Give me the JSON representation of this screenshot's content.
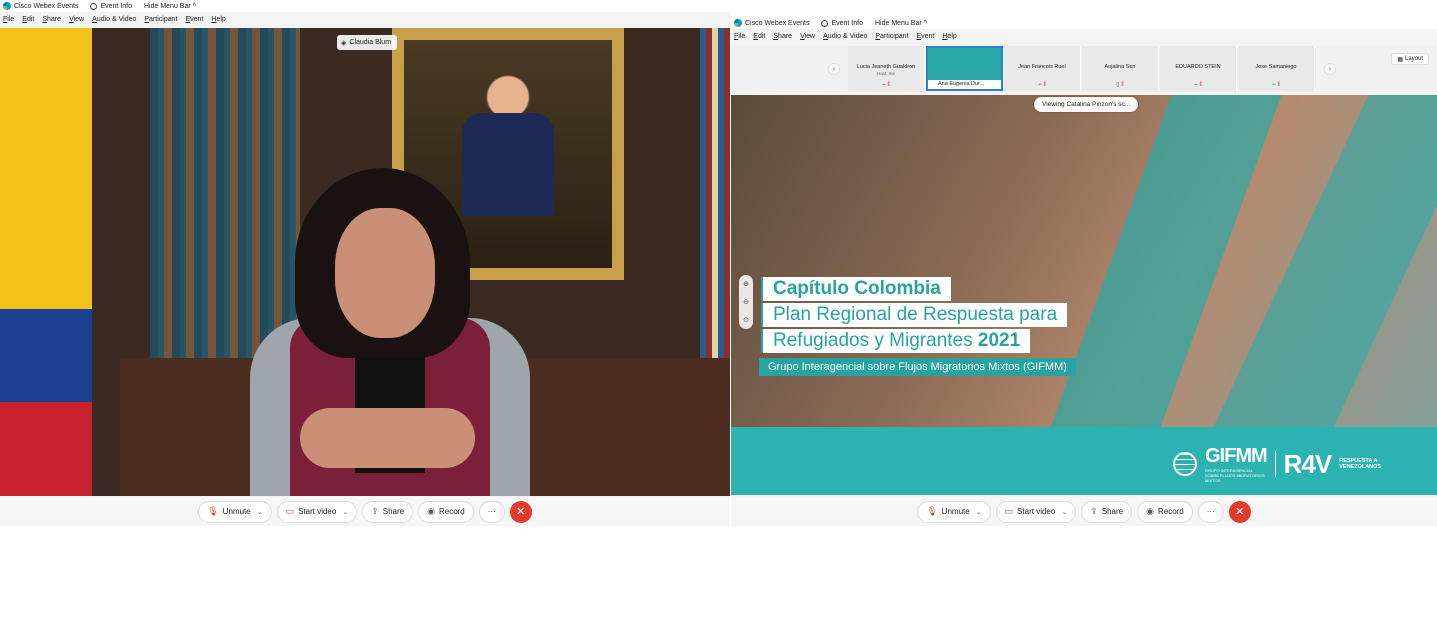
{
  "left": {
    "app_title": "Cisco Webex Events",
    "event_info": "Event Info",
    "hide_menu": "Hide Menu Bar ^",
    "menu": [
      "File",
      "Edit",
      "Share",
      "View",
      "Audio & Video",
      "Participant",
      "Event",
      "Help"
    ],
    "speaker_name": "Claudia Blum",
    "controls": {
      "unmute": "Unmute",
      "start_video": "Start video",
      "share": "Share",
      "record": "Record",
      "more": "···"
    }
  },
  "right": {
    "app_title": "Cisco Webex Events",
    "event_info": "Event Info",
    "hide_menu": "Hide Menu Bar ^",
    "menu": [
      "File",
      "Edit",
      "Share",
      "View",
      "Audio & Video",
      "Participant",
      "Event",
      "Help"
    ],
    "participants": [
      {
        "name": "Lucia Jeaneth Gualdron",
        "sub": "Host, me"
      },
      {
        "name": "Ana Eugenia Dur..."
      },
      {
        "name": "Jean Francois Ruel"
      },
      {
        "name": "Anjalina Sen"
      },
      {
        "name": "EDUARDO STEIN"
      },
      {
        "name": "Jose Samaniego"
      }
    ],
    "layout_label": "Layout",
    "viewing": "Viewing Catalina Pinzon's sc...",
    "slide": {
      "line1": "Capítulo Colombia",
      "line2": "Plan Regional de Respuesta para",
      "line3": "Refugiados y Migrantes ",
      "line3_year": "2021",
      "line4": "Grupo Interagencial sobre Flujos Migratorios Mixtos (GIFMM)",
      "gifmm": "GIFMM",
      "gifmm_sub": "GRUPO INTERAGENCIAL SOBRE FLUJOS MIGRATORIOS MIXTOS",
      "r4v": "R4V",
      "r4v_sub": "RESPUESTA A VENEZOLANOS"
    },
    "controls": {
      "unmute": "Unmute",
      "start_video": "Start video",
      "share": "Share",
      "record": "Record",
      "more": "···"
    }
  }
}
